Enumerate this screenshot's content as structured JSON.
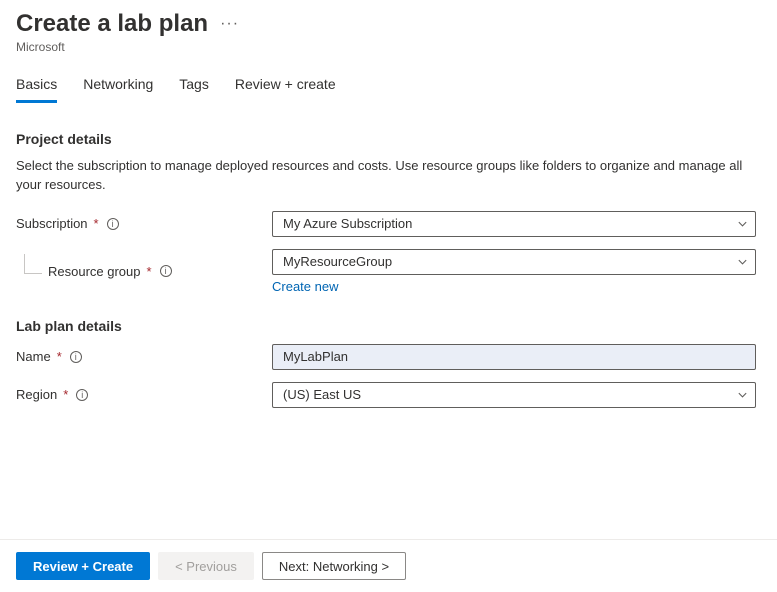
{
  "header": {
    "title": "Create a lab plan",
    "subtitle": "Microsoft"
  },
  "tabs": {
    "basics": "Basics",
    "networking": "Networking",
    "tags": "Tags",
    "review": "Review + create"
  },
  "project": {
    "section_title": "Project details",
    "description": "Select the subscription to manage deployed resources and costs. Use resource groups like folders to organize and manage all your resources.",
    "subscription_label": "Subscription",
    "subscription_value": "My Azure Subscription",
    "resource_group_label": "Resource group",
    "resource_group_value": "MyResourceGroup",
    "create_new": "Create new"
  },
  "lab": {
    "section_title": "Lab plan details",
    "name_label": "Name",
    "name_value": "MyLabPlan",
    "region_label": "Region",
    "region_value": "(US) East US"
  },
  "footer": {
    "review": "Review + Create",
    "previous": "< Previous",
    "next": "Next: Networking >"
  }
}
